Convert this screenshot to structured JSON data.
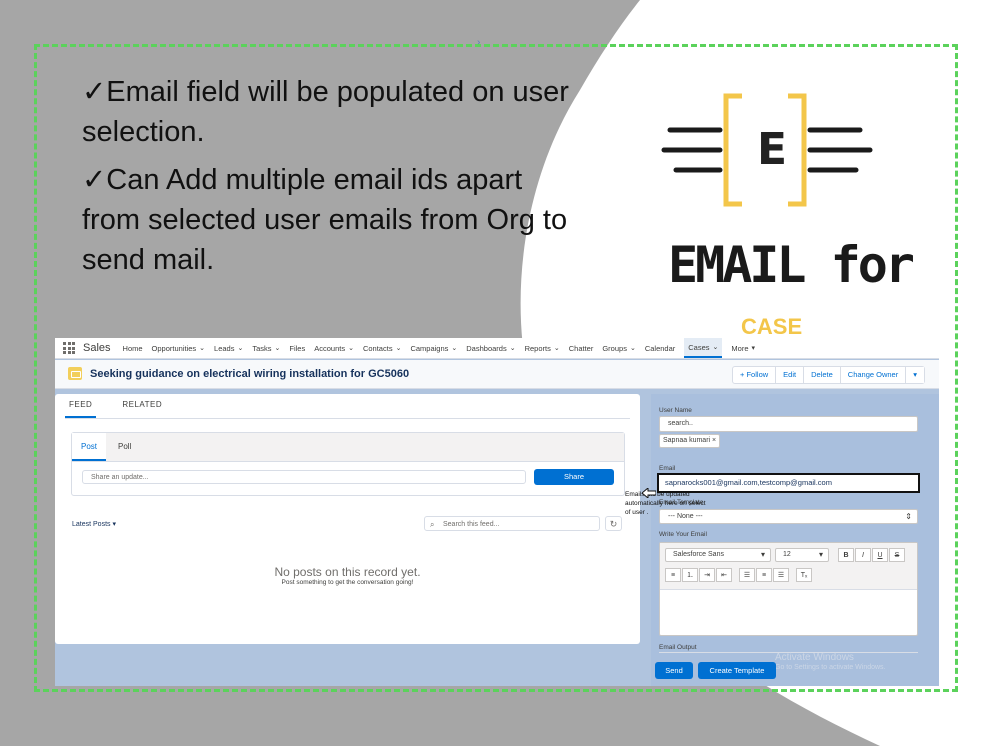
{
  "slide": {
    "bullets": [
      "✓Email field will be populated on user selection.",
      "✓Can Add multiple email ids apart from selected user emails from Org to send mail."
    ],
    "logo": {
      "letter": "E",
      "title": "EMAIL for",
      "subtitle": "CASE"
    },
    "colors": {
      "background": "#a6a6a6",
      "border": "#5bd25b",
      "bracket": "#f3c64a"
    }
  },
  "salesforce": {
    "app_name": "Sales",
    "nav": [
      "Home",
      "Opportunities",
      "Leads",
      "Tasks",
      "Files",
      "Accounts",
      "Contacts",
      "Campaigns",
      "Dashboards",
      "Reports",
      "Chatter",
      "Groups",
      "Calendar",
      "Cases",
      "More"
    ],
    "nav_dropdowns": [
      false,
      true,
      true,
      true,
      false,
      true,
      true,
      true,
      true,
      true,
      false,
      true,
      false,
      true,
      true
    ],
    "active_nav": "Cases",
    "record_title": "Seeking guidance on electrical wiring installation for GC5060",
    "actions": {
      "follow": "+ Follow",
      "edit": "Edit",
      "delete": "Delete",
      "change_owner": "Change Owner"
    },
    "feed": {
      "tabs": [
        "FEED",
        "RELATED"
      ],
      "publisher_tabs": [
        "Post",
        "Poll"
      ],
      "share_placeholder": "Share an update...",
      "share_button": "Share",
      "sort_label": "Latest Posts",
      "search_placeholder": "Search this feed...",
      "empty_title": "No posts on this record yet.",
      "empty_subtitle": "Post something to get the conversation going!"
    },
    "note": "Emails will be updated automatically here on select of user .",
    "email_panel": {
      "user_label": "User Name",
      "search_placeholder": "search..",
      "selected_user": "Sapnaa kumari",
      "email_label": "Email",
      "email_value": "sapnarocks001@gmail.com,testcomp@gmail.com",
      "template_label": "Email Template",
      "template_value": "--- None ---",
      "write_label": "Write Your Email",
      "font": "Salesforce Sans",
      "size": "12",
      "output_label": "Email Output",
      "send_button": "Send",
      "create_template_button": "Create Template",
      "watermark_title": "Activate Windows",
      "watermark_sub": "Go to Settings to activate Windows."
    }
  }
}
